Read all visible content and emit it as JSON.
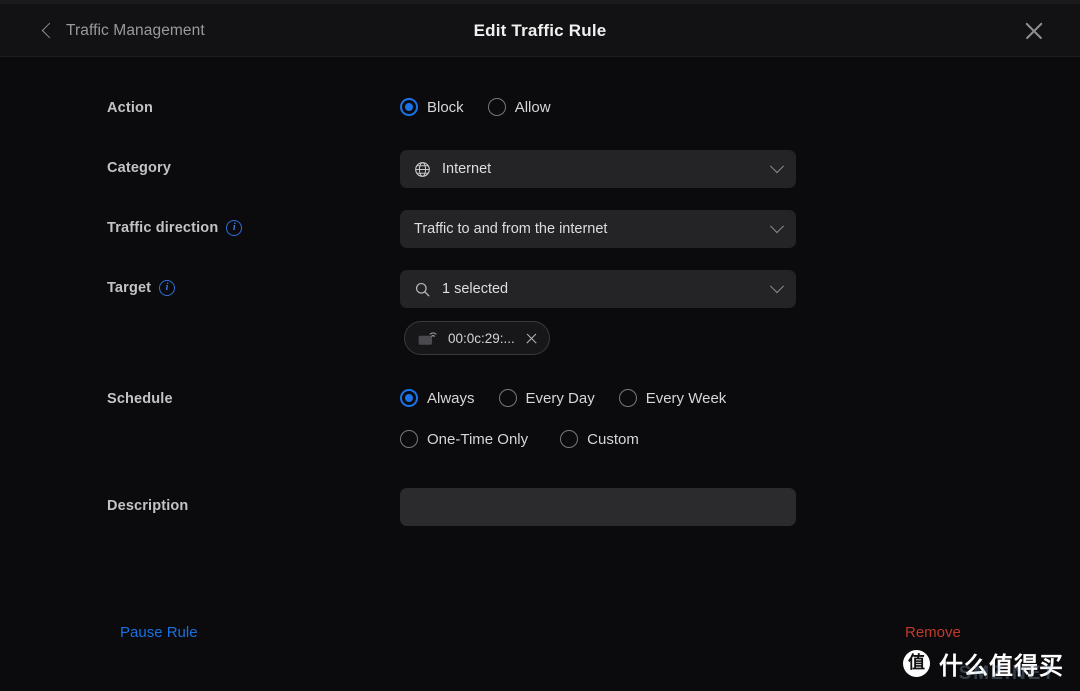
{
  "header": {
    "back_label": "Traffic Management",
    "back_icon": "chevron-left-icon",
    "title": "Edit Traffic Rule",
    "close_icon": "close-icon"
  },
  "form": {
    "action": {
      "label": "Action",
      "options": [
        {
          "label": "Block",
          "selected": true
        },
        {
          "label": "Allow",
          "selected": false
        }
      ]
    },
    "category": {
      "label": "Category",
      "icon": "globe-icon",
      "value": "Internet",
      "chevron": "chevron-down-icon"
    },
    "traffic_direction": {
      "label": "Traffic direction",
      "info_icon": "info-icon",
      "value": "Traffic to and from the internet",
      "chevron": "chevron-down-icon"
    },
    "target": {
      "label": "Target",
      "info_icon": "info-icon",
      "search_icon": "search-icon",
      "value": "1 selected",
      "chevron": "chevron-down-icon",
      "chips": [
        {
          "icon": "device-icon",
          "label": "00:0c:29:...",
          "remove_icon": "close-icon"
        }
      ]
    },
    "schedule": {
      "label": "Schedule",
      "options": [
        {
          "label": "Always",
          "selected": true
        },
        {
          "label": "Every Day",
          "selected": false
        },
        {
          "label": "Every Week",
          "selected": false
        },
        {
          "label": "One-Time Only",
          "selected": false
        },
        {
          "label": "Custom",
          "selected": false
        }
      ]
    },
    "description": {
      "label": "Description",
      "value": "",
      "placeholder": ""
    }
  },
  "footer": {
    "pause_label": "Pause Rule",
    "remove_label": "Remove"
  },
  "watermark": {
    "logo_char": "值",
    "text": "什么值得买",
    "subtext": "SMZ.NET"
  },
  "colors": {
    "accent_blue": "#1a73e8",
    "link_blue": "#1a6fe0",
    "danger_red": "#c0392b",
    "page_bg": "#0b0b0d",
    "header_bg": "#121214",
    "field_bg": "#242427",
    "input_bg": "#2b2b2e"
  }
}
